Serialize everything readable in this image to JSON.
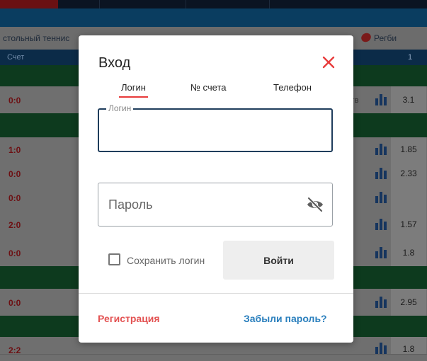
{
  "background": {
    "sport_left": "стольный теннис",
    "sport_right": "Регби",
    "table_head_left": "Счет",
    "table_head_right": "1",
    "rows": [
      {
        "score": "0:0",
        "odds": "3.1",
        "tag": "лн тв"
      },
      {
        "score": "1:0",
        "odds": "1.85",
        "tag": ""
      },
      {
        "score": "0:0",
        "odds": "2.33",
        "tag": ""
      },
      {
        "score": "0:0",
        "odds": "",
        "tag": ""
      },
      {
        "score": "2:0",
        "odds": "1.57",
        "tag": ""
      },
      {
        "score": "0:0",
        "odds": "1.8",
        "tag": ""
      },
      {
        "score": "0:0",
        "odds": "2.95",
        "tag": ""
      },
      {
        "score": "2:2",
        "odds": "1.8",
        "tag": ""
      }
    ]
  },
  "modal": {
    "title": "Вход",
    "tabs": [
      {
        "label": "Логин",
        "active": true
      },
      {
        "label": "№ счета",
        "active": false
      },
      {
        "label": "Телефон",
        "active": false
      }
    ],
    "login_field": {
      "legend": "Логин",
      "value": "",
      "placeholder": ""
    },
    "password_field": {
      "value": "",
      "placeholder": "Пароль"
    },
    "remember_label": "Сохранить логин",
    "remember_checked": false,
    "login_button": "Войти",
    "register_link": "Регистрация",
    "forgot_link": "Забыли пароль?",
    "icons": {
      "close": "close-icon",
      "eye": "eye-off-icon"
    }
  },
  "colors": {
    "accent_red": "#e83b3b",
    "link_blue": "#2a7fbd",
    "register_red": "#e35252",
    "focus_border": "#1f3d5c"
  }
}
